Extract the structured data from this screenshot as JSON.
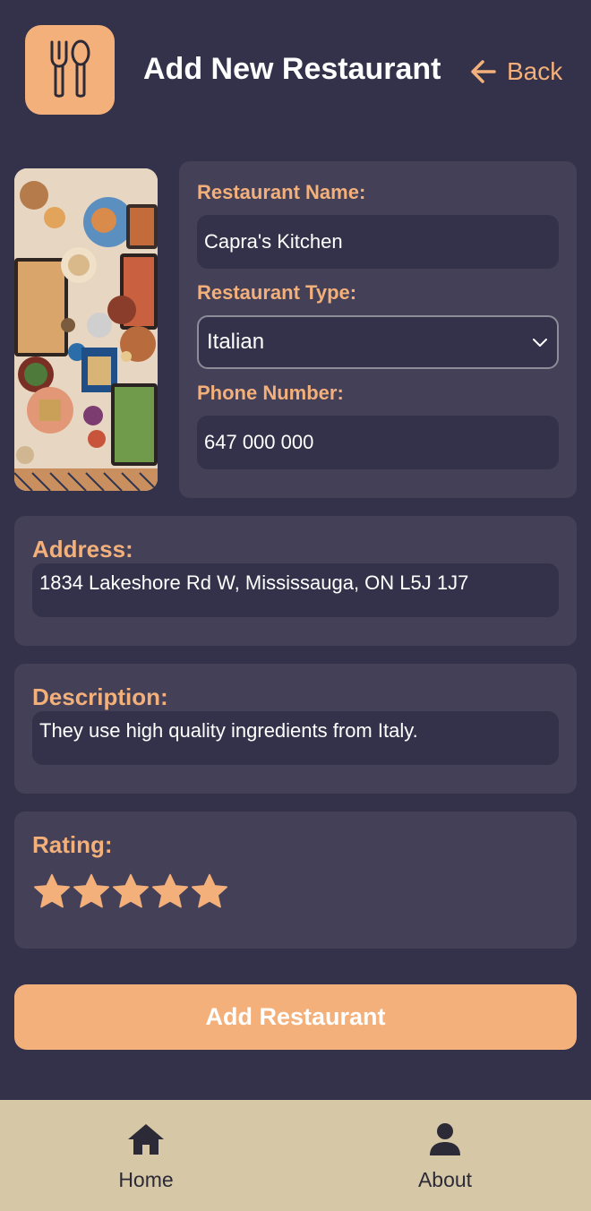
{
  "header": {
    "logo_icon": "fork-spoon-icon",
    "title": "Add New Restaurant",
    "back_label": "Back",
    "back_icon": "arrow-left-icon"
  },
  "form": {
    "name": {
      "label": "Restaurant Name:",
      "value": "Capra's Kitchen"
    },
    "type": {
      "label": "Restaurant Type:",
      "value": "Italian"
    },
    "phone": {
      "label": "Phone Number:",
      "value": "647 000 000"
    },
    "address": {
      "label": "Address:",
      "value": "1834 Lakeshore Rd W, Mississauga, ON L5J 1J7"
    },
    "description": {
      "label": "Description:",
      "value": "They use high quality ingredients from Italy."
    },
    "rating": {
      "label": "Rating:",
      "value": 5,
      "max": 5
    }
  },
  "submit_label": "Add Restaurant",
  "nav": {
    "home_label": "Home",
    "about_label": "About"
  },
  "colors": {
    "background": "#33324a",
    "card": "#434057",
    "accent": "#f4b07a",
    "nav_bg": "#d6c7a6"
  }
}
